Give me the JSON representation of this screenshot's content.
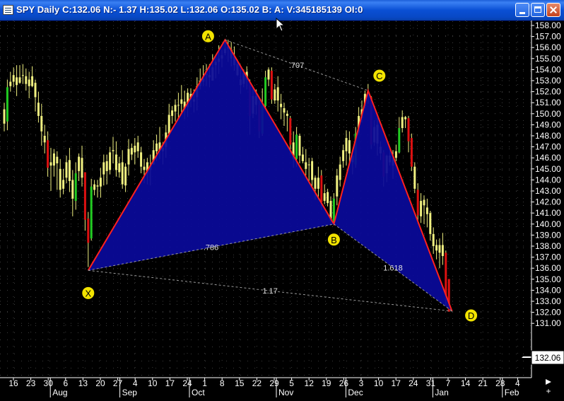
{
  "window": {
    "title": "SPY Daily C:132.06 N:- 1.37 H:135.02 L:132.06 O:135.02 B: A: V:345185139 OI:0",
    "buttons": [
      "minimize-icon",
      "maximize-icon",
      "close-icon"
    ]
  },
  "icons": {
    "app": "chart-window-icon",
    "cursor": "mouse-pointer-icon",
    "scroll_right": "scroll-right-arrow-icon",
    "scroll_plus": "plus-icon"
  },
  "colors": {
    "background": "#000000",
    "grid_dots": "#3c3c3c",
    "candle_up": "#22cc22",
    "candle_down": "#dd1111",
    "candle_neutral": "#f0f080",
    "pattern_fill": "#0a0a9a",
    "pattern_edge": "#ff2020",
    "pattern_label_fill": "#f2e300",
    "axis_text": "#ffffff",
    "price_box": "#ffffff"
  },
  "chart_data": {
    "type": "candlestick",
    "y_axis": {
      "min": 131,
      "max": 158,
      "step": 1,
      "position": "right",
      "ticks": [
        "158.00",
        "157.00",
        "156.00",
        "155.00",
        "154.00",
        "153.00",
        "152.00",
        "151.00",
        "150.00",
        "149.00",
        "148.00",
        "147.00",
        "146.00",
        "145.00",
        "144.00",
        "143.00",
        "142.00",
        "141.00",
        "140.00",
        "139.00",
        "138.00",
        "137.00",
        "136.00",
        "135.00",
        "134.00",
        "133.00",
        "132.00",
        "131.00"
      ],
      "last_price_label": "132.06"
    },
    "x_axis": {
      "day_ticks": [
        "16",
        "23",
        "30",
        "6",
        "13",
        "20",
        "27",
        "4",
        "10",
        "17",
        "24",
        "1",
        "8",
        "15",
        "22",
        "29",
        "5",
        "12",
        "19",
        "26",
        "3",
        "10",
        "17",
        "24",
        "31",
        "7",
        "14",
        "21",
        "28",
        "4"
      ],
      "month_labels": [
        {
          "label": "Aug",
          "after_tick": 2
        },
        {
          "label": "Sep",
          "after_tick": 6
        },
        {
          "label": "Oct",
          "after_tick": 10
        },
        {
          "label": "Nov",
          "after_tick": 15
        },
        {
          "label": "Dec",
          "after_tick": 19
        },
        {
          "label": "Jan",
          "after_tick": 24
        },
        {
          "label": "Feb",
          "after_tick": 28
        }
      ],
      "grid": "dotted"
    },
    "harmonic_pattern": {
      "type": "butterfly",
      "points": [
        {
          "label": "X",
          "index": 27,
          "price": 135.8
        },
        {
          "label": "A",
          "index": 71,
          "price": 156.7
        },
        {
          "label": "B",
          "index": 106,
          "price": 140.0
        },
        {
          "label": "C",
          "index": 117,
          "price": 152.1
        },
        {
          "label": "D",
          "index": 144,
          "price": 132.1
        }
      ],
      "ratios": [
        {
          "label": ".707",
          "from": "A",
          "to": "C"
        },
        {
          "label": ".786",
          "from": "X",
          "to": "B"
        },
        {
          "label": "1.618",
          "from": "B",
          "to": "D"
        },
        {
          "label": "1.17",
          "from": "X",
          "to": "D"
        }
      ]
    },
    "candles": [
      [
        150.4,
        149.1,
        151.0,
        148.4
      ],
      [
        149.3,
        152.4,
        153.1,
        148.5
      ],
      [
        152.5,
        152.9,
        153.8,
        152.0
      ],
      [
        152.9,
        153.5,
        154.2,
        152.4
      ],
      [
        153.3,
        152.6,
        154.4,
        151.6
      ],
      [
        152.8,
        153.3,
        154.4,
        152.7
      ],
      [
        153.5,
        153.5,
        154.5,
        152.7
      ],
      [
        153.4,
        152.7,
        154.1,
        152.1
      ],
      [
        153.1,
        152.5,
        153.8,
        151.4
      ],
      [
        152.5,
        153.4,
        154.3,
        152.4
      ],
      [
        152.8,
        151.5,
        153.1,
        150.2
      ],
      [
        151.0,
        149.8,
        152.0,
        149.2
      ],
      [
        149.8,
        148.4,
        150.9,
        147.1
      ],
      [
        148.0,
        147.4,
        149.0,
        146.4
      ],
      [
        147.6,
        145.1,
        148.4,
        144.3
      ],
      [
        145.3,
        145.6,
        146.9,
        143.0
      ],
      [
        145.3,
        146.4,
        146.8,
        144.3
      ],
      [
        146.1,
        145.5,
        146.6,
        143.1
      ],
      [
        145.0,
        143.1,
        145.9,
        142.4
      ],
      [
        143.2,
        144.0,
        145.0,
        142.7
      ],
      [
        144.2,
        145.6,
        146.2,
        143.7
      ],
      [
        145.8,
        143.9,
        146.9,
        142.9
      ],
      [
        144.0,
        142.3,
        144.9,
        140.7
      ],
      [
        142.1,
        144.6,
        145.6,
        141.3
      ],
      [
        144.8,
        146.1,
        146.4,
        143.9
      ],
      [
        146.0,
        144.2,
        147.1,
        143.4
      ],
      [
        144.7,
        140.4,
        144.7,
        139.4
      ],
      [
        140.5,
        138.3,
        141.1,
        136.1
      ],
      [
        138.7,
        143.4,
        144.1,
        138.5
      ],
      [
        143.1,
        143.6,
        144.0,
        142.6
      ],
      [
        143.4,
        143.5,
        144.0,
        142.4
      ],
      [
        143.4,
        144.2,
        145.1,
        142.4
      ],
      [
        144.5,
        145.6,
        146.3,
        143.5
      ],
      [
        145.7,
        144.8,
        146.3,
        143.6
      ],
      [
        144.9,
        146.5,
        147.0,
        144.5
      ],
      [
        146.6,
        146.7,
        147.9,
        145.5
      ],
      [
        146.3,
        144.9,
        147.5,
        144.3
      ],
      [
        144.7,
        145.5,
        146.1,
        144.2
      ],
      [
        145.6,
        143.6,
        146.7,
        143.2
      ],
      [
        143.5,
        145.2,
        145.5,
        142.9
      ],
      [
        145.4,
        146.8,
        147.7,
        144.4
      ],
      [
        146.9,
        146.3,
        147.3,
        145.8
      ],
      [
        146.5,
        147.1,
        147.8,
        145.4
      ],
      [
        147.4,
        146.6,
        148.0,
        146.0
      ],
      [
        146.5,
        145.2,
        147.0,
        144.6
      ],
      [
        145.2,
        144.9,
        145.9,
        143.7
      ],
      [
        144.6,
        145.6,
        146.0,
        143.6
      ],
      [
        145.3,
        144.9,
        146.3,
        143.5
      ],
      [
        145.4,
        146.7,
        147.6,
        145.4
      ],
      [
        146.6,
        147.3,
        148.1,
        145.7
      ],
      [
        147.4,
        146.7,
        148.8,
        145.9
      ],
      [
        146.6,
        146.9,
        147.4,
        145.4
      ],
      [
        147.0,
        148.3,
        149.0,
        146.0
      ],
      [
        148.2,
        149.9,
        150.9,
        147.8
      ],
      [
        149.8,
        150.3,
        150.7,
        149.1
      ],
      [
        150.2,
        150.8,
        151.3,
        149.3
      ],
      [
        150.8,
        150.8,
        151.9,
        149.6
      ],
      [
        150.9,
        151.3,
        152.6,
        149.9
      ],
      [
        151.1,
        150.4,
        152.1,
        149.5
      ],
      [
        150.6,
        151.9,
        152.3,
        149.7
      ],
      [
        151.8,
        151.3,
        152.3,
        150.6
      ],
      [
        151.1,
        151.3,
        152.2,
        150.1
      ],
      [
        151.5,
        152.5,
        153.3,
        150.3
      ],
      [
        152.5,
        153.0,
        154.1,
        152.2
      ],
      [
        152.9,
        153.2,
        154.4,
        152.5
      ],
      [
        153.6,
        153.5,
        154.5,
        152.5
      ],
      [
        153.5,
        153.3,
        154.5,
        152.4
      ],
      [
        153.0,
        154.2,
        155.4,
        153.0
      ],
      [
        154.4,
        154.7,
        155.3,
        153.2
      ],
      [
        154.7,
        155.0,
        156.2,
        153.6
      ],
      [
        155.0,
        155.3,
        155.8,
        154.2
      ],
      [
        155.5,
        155.9,
        156.7,
        155.3
      ],
      [
        156.1,
        155.9,
        156.7,
        154.7
      ],
      [
        155.8,
        155.0,
        156.5,
        154.3
      ],
      [
        155.2,
        154.4,
        156.1,
        153.9
      ],
      [
        154.5,
        153.5,
        154.9,
        153.4
      ],
      [
        153.1,
        152.6,
        154.1,
        151.8
      ],
      [
        152.7,
        153.7,
        154.0,
        152.4
      ],
      [
        153.8,
        153.1,
        154.3,
        152.2
      ],
      [
        152.8,
        149.8,
        153.1,
        148.1
      ],
      [
        150.0,
        151.6,
        152.3,
        149.6
      ],
      [
        151.6,
        150.8,
        152.2,
        149.9
      ],
      [
        150.8,
        148.4,
        151.2,
        147.8
      ],
      [
        148.2,
        150.7,
        152.3,
        148.0
      ],
      [
        150.7,
        153.3,
        153.9,
        150.4
      ],
      [
        153.1,
        154.0,
        154.2,
        152.5
      ],
      [
        153.9,
        151.3,
        154.2,
        150.9
      ],
      [
        151.2,
        152.2,
        152.7,
        150.9
      ],
      [
        152.4,
        151.2,
        153.4,
        150.2
      ],
      [
        150.9,
        150.6,
        151.8,
        149.5
      ],
      [
        150.5,
        150.1,
        151.0,
        148.9
      ],
      [
        150.0,
        149.8,
        150.3,
        148.4
      ],
      [
        149.6,
        147.2,
        149.8,
        146.3
      ],
      [
        147.4,
        145.9,
        148.4,
        145.1
      ],
      [
        145.9,
        148.1,
        148.8,
        145.2
      ],
      [
        148.0,
        146.2,
        148.2,
        145.5
      ],
      [
        146.3,
        145.7,
        147.0,
        145.5
      ],
      [
        145.6,
        145.0,
        146.8,
        144.4
      ],
      [
        145.4,
        145.4,
        146.0,
        143.9
      ],
      [
        145.7,
        144.0,
        146.0,
        143.4
      ],
      [
        144.2,
        143.2,
        144.4,
        142.2
      ],
      [
        143.2,
        144.2,
        145.2,
        142.2
      ],
      [
        144.4,
        142.0,
        144.9,
        141.3
      ],
      [
        142.1,
        142.8,
        143.6,
        141.8
      ],
      [
        142.9,
        141.9,
        143.2,
        141.6
      ],
      [
        142.1,
        140.3,
        142.5,
        139.9
      ],
      [
        140.2,
        142.3,
        142.8,
        140.1
      ],
      [
        142.5,
        144.4,
        145.0,
        141.7
      ],
      [
        144.0,
        145.4,
        146.1,
        143.4
      ],
      [
        145.7,
        146.7,
        147.2,
        145.1
      ],
      [
        146.6,
        147.8,
        148.5,
        145.3
      ],
      [
        147.6,
        146.4,
        148.4,
        145.6
      ],
      [
        146.2,
        145.6,
        146.4,
        144.5
      ],
      [
        145.4,
        148.2,
        148.8,
        145.1
      ],
      [
        148.3,
        149.8,
        150.6,
        148.1
      ],
      [
        149.6,
        150.4,
        151.2,
        149.2
      ],
      [
        150.7,
        151.8,
        152.1,
        150.5
      ],
      [
        151.8,
        152.0,
        152.7,
        150.9
      ],
      [
        151.5,
        147.2,
        151.6,
        146.8
      ],
      [
        147.4,
        148.8,
        149.4,
        147.1
      ],
      [
        149.0,
        147.3,
        149.6,
        146.2
      ],
      [
        147.0,
        146.4,
        147.5,
        145.8
      ],
      [
        146.5,
        144.3,
        146.7,
        143.4
      ],
      [
        144.6,
        146.2,
        146.3,
        143.8
      ],
      [
        146.2,
        145.6,
        146.9,
        145.3
      ],
      [
        145.3,
        146.0,
        146.7,
        144.1
      ],
      [
        146.0,
        146.6,
        147.2,
        145.7
      ],
      [
        146.5,
        148.7,
        149.7,
        146.4
      ],
      [
        148.7,
        149.7,
        150.3,
        148.3
      ],
      [
        149.5,
        149.7,
        149.8,
        148.7
      ],
      [
        149.6,
        147.5,
        149.8,
        146.5
      ],
      [
        147.8,
        145.2,
        148.2,
        144.8
      ],
      [
        145.2,
        143.2,
        145.6,
        142.8
      ],
      [
        143.1,
        140.8,
        143.7,
        140.0
      ],
      [
        140.7,
        142.1,
        142.8,
        140.1
      ],
      [
        142.2,
        141.7,
        142.6,
        140.0
      ],
      [
        141.5,
        140.9,
        142.3,
        139.7
      ],
      [
        141.0,
        139.1,
        141.2,
        138.5
      ],
      [
        139.1,
        138.0,
        139.7,
        137.3
      ],
      [
        138.1,
        137.6,
        138.6,
        136.8
      ],
      [
        137.4,
        138.1,
        138.7,
        136.0
      ],
      [
        138.1,
        137.1,
        139.2,
        136.3
      ],
      [
        137.4,
        133.1,
        137.6,
        132.6
      ],
      [
        135.02,
        132.06,
        135.02,
        132.06
      ]
    ]
  }
}
